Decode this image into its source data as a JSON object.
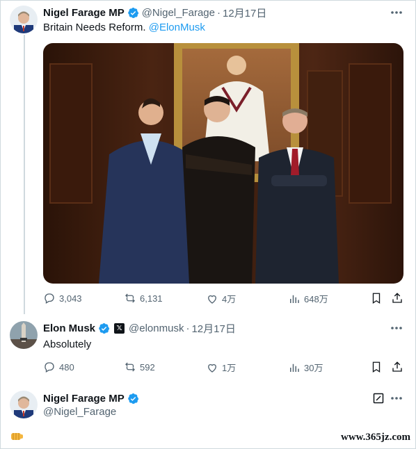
{
  "tweet1": {
    "author": "Nigel Farage MP",
    "handle": "@Nigel_Farage",
    "dot": "·",
    "time": "12月17日",
    "text": "Britain Needs Reform. ",
    "mention": "@ElonMusk",
    "stats": {
      "replies": "3,043",
      "retweets": "6,131",
      "likes": "4万",
      "views": "648万"
    }
  },
  "tweet2": {
    "author": "Elon Musk",
    "handle": "@elonmusk",
    "dot": "·",
    "time": "12月17日",
    "text": "Absolutely",
    "stats": {
      "replies": "480",
      "retweets": "592",
      "likes": "1万",
      "views": "30万"
    }
  },
  "reply": {
    "author": "Nigel Farage MP",
    "handle": "@Nigel_Farage"
  },
  "watermark": "www.365jz.com",
  "colors": {
    "accent": "#1d9bf0",
    "text": "#0f1419",
    "muted": "#536471",
    "border": "#cfd9de"
  },
  "icons": [
    "verified-badge-icon",
    "more-icon",
    "reply-icon",
    "retweet-icon",
    "like-icon",
    "views-icon",
    "bookmark-icon",
    "share-icon",
    "x-affiliate-icon",
    "edit-icon",
    "fist-emoji-icon"
  ]
}
